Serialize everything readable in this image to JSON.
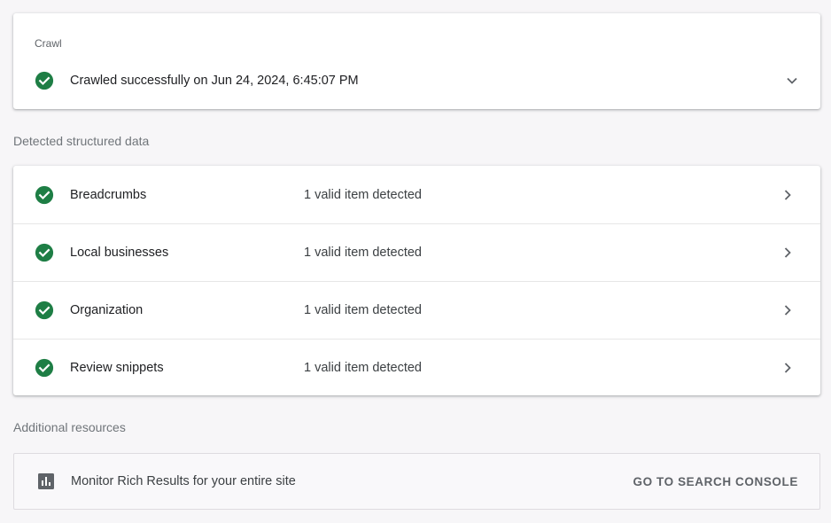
{
  "crawl": {
    "label": "Crawl",
    "status_text": "Crawled successfully on Jun 24, 2024, 6:45:07 PM"
  },
  "structured_data": {
    "heading": "Detected structured data",
    "items": [
      {
        "name": "Breadcrumbs",
        "status": "1 valid item detected"
      },
      {
        "name": "Local businesses",
        "status": "1 valid item detected"
      },
      {
        "name": "Organization",
        "status": "1 valid item detected"
      },
      {
        "name": "Review snippets",
        "status": "1 valid item detected"
      }
    ]
  },
  "resources": {
    "heading": "Additional resources",
    "text": "Monitor Rich Results for your entire site",
    "button_label": "GO TO SEARCH CONSOLE"
  },
  "icons": {
    "check": "check-circle-icon",
    "expand": "chevron-down-icon",
    "open": "chevron-right-icon",
    "chart": "bar-chart-icon"
  },
  "colors": {
    "success": "#1e7e45",
    "icon_gray": "#5f6368"
  }
}
